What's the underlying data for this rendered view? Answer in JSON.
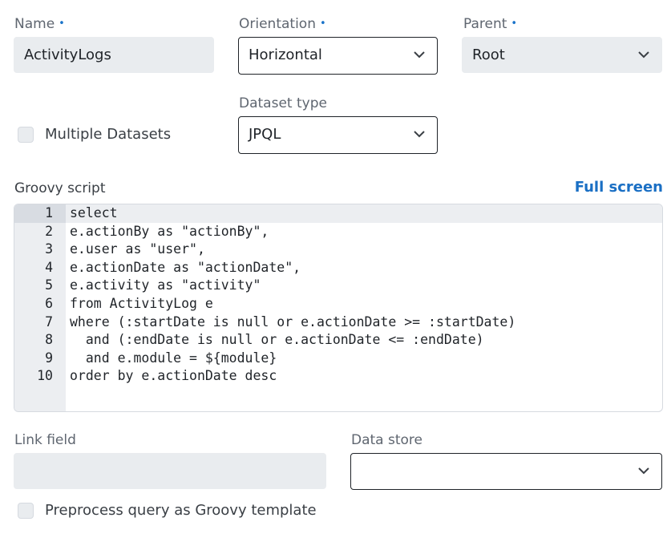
{
  "form": {
    "name": {
      "label": "Name",
      "value": "ActivityLogs"
    },
    "orientation": {
      "label": "Orientation",
      "value": "Horizontal"
    },
    "parent": {
      "label": "Parent",
      "value": "Root"
    },
    "dataset_type": {
      "label": "Dataset type",
      "value": "JPQL"
    },
    "multiple_datasets": {
      "label": "Multiple Datasets",
      "checked": false
    },
    "required_marker": "•"
  },
  "script": {
    "label": "Groovy script",
    "full_screen_label": "Full screen",
    "lines": [
      {
        "num": "1",
        "text": "select"
      },
      {
        "num": "2",
        "text": "e.actionBy as \"actionBy\","
      },
      {
        "num": "3",
        "text": "e.user as \"user\","
      },
      {
        "num": "4",
        "text": "e.actionDate as \"actionDate\","
      },
      {
        "num": "5",
        "text": "e.activity as \"activity\""
      },
      {
        "num": "6",
        "text": "from ActivityLog e"
      },
      {
        "num": "7",
        "text": "where (:startDate is null or e.actionDate >= :startDate)"
      },
      {
        "num": "8",
        "text": "  and (:endDate is null or e.actionDate <= :endDate)"
      },
      {
        "num": "9",
        "text": "  and e.module = ${module}"
      },
      {
        "num": "10",
        "text": "order by e.actionDate desc"
      }
    ]
  },
  "link_field": {
    "label": "Link field",
    "value": ""
  },
  "data_store": {
    "label": "Data store",
    "value": ""
  },
  "preprocess": {
    "label": "Preprocess query as Groovy template",
    "checked": false
  },
  "colors": {
    "accent": "#1a6fc4",
    "readonly_bg": "#e9ecef",
    "gutter_bg": "#eceef1"
  },
  "icons": {
    "dropdown": "chevron-down-icon"
  }
}
